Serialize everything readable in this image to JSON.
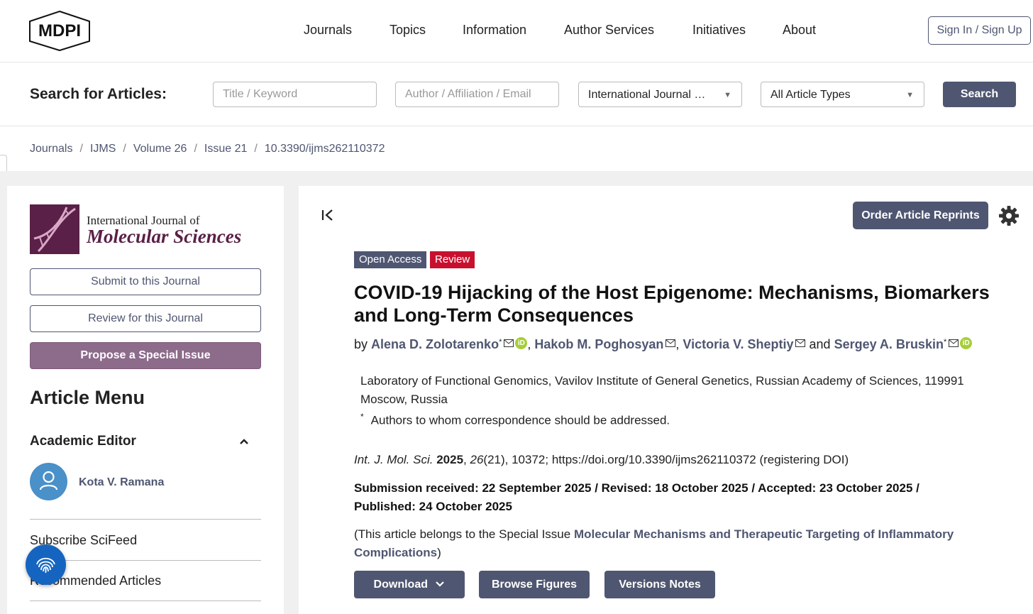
{
  "header": {
    "logo_text": "MDPI",
    "nav": [
      "Journals",
      "Topics",
      "Information",
      "Author Services",
      "Initiatives",
      "About"
    ],
    "signin_label": "Sign In / Sign Up"
  },
  "search": {
    "label": "Search for Articles:",
    "title_placeholder": "Title / Keyword",
    "author_placeholder": "Author / Affiliation / Email",
    "journal_value": "International Journal …",
    "type_value": "All Article Types",
    "button_label": "Search"
  },
  "breadcrumb": [
    "Journals",
    "IJMS",
    "Volume 26",
    "Issue 21",
    "10.3390/ijms262110372"
  ],
  "sidebar": {
    "journal_line1": "International Journal of",
    "journal_line2": "Molecular Sciences",
    "submit_label": "Submit to this Journal",
    "review_label": "Review for this Journal",
    "propose_label": "Propose a Special Issue",
    "menu_title": "Article Menu",
    "academic_editor_title": "Academic Editor",
    "editor_name": "Kota V. Ramana",
    "links": [
      "Subscribe SciFeed",
      "Recommended Articles"
    ]
  },
  "article": {
    "reprints_label": "Order Article Reprints",
    "badges": {
      "open_access": "Open Access",
      "type": "Review"
    },
    "title": "COVID-19 Hijacking of the Host Epigenome: Mechanisms, Biomarkers and Long-Term Consequences",
    "by": "by",
    "and": "and",
    "authors": [
      "Alena D. Zolotarenko",
      "Hakob M. Poghosyan",
      "Victoria V. Sheptiy",
      "Sergey A. Bruskin"
    ],
    "corr_mark": "*",
    "orcid_label": "iD",
    "affiliation": "Laboratory of Functional Genomics, Vavilov Institute of General Genetics, Russian Academy of Sciences, 119991 Moscow, Russia",
    "correspondence": "Authors to whom correspondence should be addressed.",
    "citation": {
      "journal": "Int. J. Mol. Sci.",
      "year": "2025",
      "volume": "26",
      "rest": "(21), 10372; https://doi.org/10.3390/ijms262110372 (registering DOI)"
    },
    "dates": "Submission received: 22 September 2025 / Revised: 18 October 2025 / Accepted: 23 October 2025 / Published: 24 October 2025",
    "special_prefix": "(This article belongs to the Special Issue ",
    "special_issue": "Molecular Mechanisms and Therapeutic Targeting of Inflammatory Complications",
    "special_suffix": ")",
    "buttons": {
      "download": "Download",
      "figures": "Browse Figures",
      "versions": "Versions Notes"
    }
  },
  "colors": {
    "primary": "#4f5671",
    "journal": "#5a2047",
    "review_badge": "#c8102e",
    "propose": "#8c6b8b",
    "orcid": "#a6ce39",
    "fingerprint": "#1565c0"
  }
}
